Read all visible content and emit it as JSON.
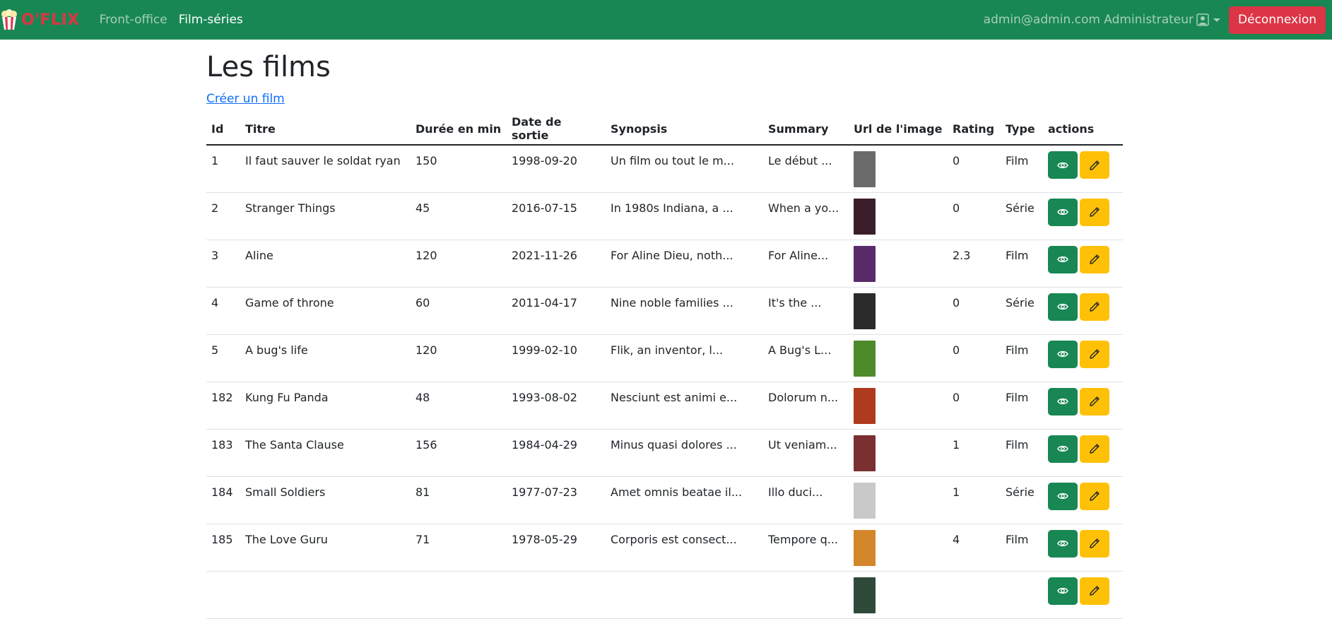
{
  "colors": {
    "navbar": "#198754",
    "brand": "#dc3545",
    "logout": "#dc3545",
    "view_button": "#198754",
    "edit_button": "#ffc107",
    "link": "#0d6efd"
  },
  "navbar": {
    "brand_icon": "popcorn-icon",
    "brand": "O'FLIX",
    "links": [
      "Front-office",
      "Film-séries"
    ],
    "active_link": "Film-séries",
    "user_label": "admin@admin.com Administrateur",
    "user_icon": "user-square-icon",
    "logout_label": "Déconnexion"
  },
  "page": {
    "title": "Les films",
    "create_link": "Créer un film"
  },
  "table": {
    "headers": [
      "Id",
      "Titre",
      "Durée en min",
      "Date de sortie",
      "Synopsis",
      "Summary",
      "Url de l'image",
      "Rating",
      "Type",
      "actions"
    ],
    "rows": [
      {
        "id": "1",
        "title": "Il faut sauver le soldat ryan",
        "duration": "150",
        "date": "1998-09-20",
        "synopsis": "Un film ou tout le m...",
        "summary": "Le début ...",
        "poster_color": "#6b6b6b",
        "rating": "0",
        "type": "Film"
      },
      {
        "id": "2",
        "title": "Stranger Things",
        "duration": "45",
        "date": "2016-07-15",
        "synopsis": "In 1980s Indiana, a ...",
        "summary": "When a yo...",
        "poster_color": "#3a1f2a",
        "rating": "0",
        "type": "Série"
      },
      {
        "id": "3",
        "title": "Aline",
        "duration": "120",
        "date": "2021-11-26",
        "synopsis": "For Aline Dieu, noth...",
        "summary": "For Aline...",
        "poster_color": "#5a2a6a",
        "rating": "2.3",
        "type": "Film"
      },
      {
        "id": "4",
        "title": "Game of throne",
        "duration": "60",
        "date": "2011-04-17",
        "synopsis": "Nine noble families ...",
        "summary": "It's the ...",
        "poster_color": "#2b2b2b",
        "rating": "0",
        "type": "Série"
      },
      {
        "id": "5",
        "title": "A bug's life",
        "duration": "120",
        "date": "1999-02-10",
        "synopsis": "Flik, an inventor, l...",
        "summary": "A Bug's L...",
        "poster_color": "#4f8a2a",
        "rating": "0",
        "type": "Film"
      },
      {
        "id": "182",
        "title": "Kung Fu Panda",
        "duration": "48",
        "date": "1993-08-02",
        "synopsis": "Nesciunt est animi e...",
        "summary": "Dolorum n...",
        "poster_color": "#b03a1e",
        "rating": "0",
        "type": "Film"
      },
      {
        "id": "183",
        "title": "The Santa Clause",
        "duration": "156",
        "date": "1984-04-29",
        "synopsis": "Minus quasi dolores ...",
        "summary": "Ut veniam...",
        "poster_color": "#7a3030",
        "rating": "1",
        "type": "Film"
      },
      {
        "id": "184",
        "title": "Small Soldiers",
        "duration": "81",
        "date": "1977-07-23",
        "synopsis": "Amet omnis beatae il...",
        "summary": "Illo duci...",
        "poster_color": "#c9c9c9",
        "rating": "1",
        "type": "Série"
      },
      {
        "id": "185",
        "title": "The Love Guru",
        "duration": "71",
        "date": "1978-05-29",
        "synopsis": "Corporis est consect...",
        "summary": "Tempore q...",
        "poster_color": "#d4872a",
        "rating": "4",
        "type": "Film"
      },
      {
        "id": "",
        "title": "",
        "duration": "",
        "date": "",
        "synopsis": "",
        "summary": "",
        "poster_color": "#2f4a3a",
        "rating": "",
        "type": ""
      }
    ],
    "action_icons": [
      "eye-icon",
      "pencil-icon"
    ]
  }
}
